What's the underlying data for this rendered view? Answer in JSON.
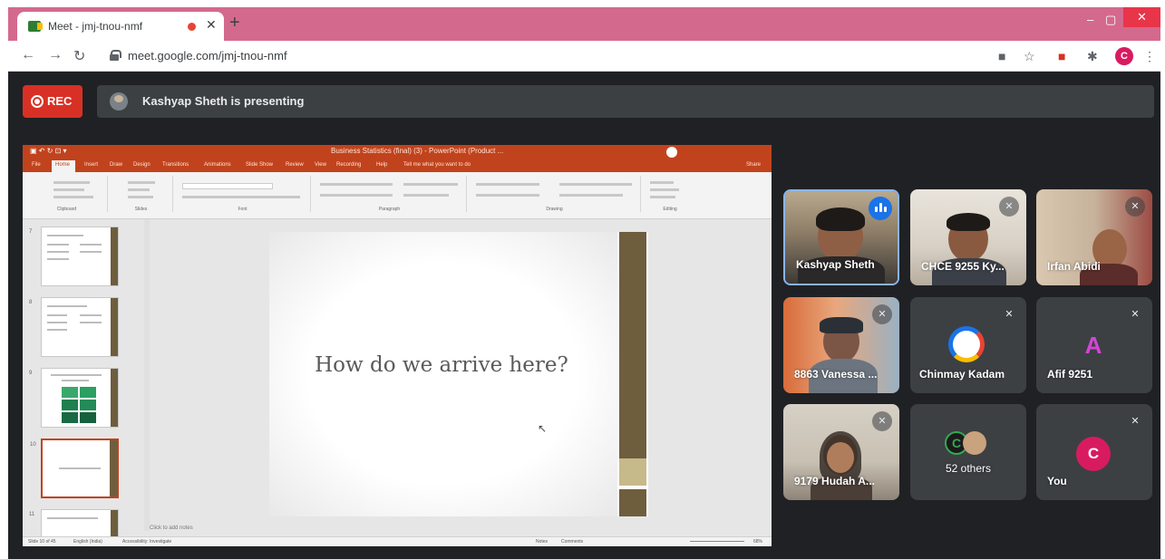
{
  "browser": {
    "tab_title": "Meet - jmj-tnou-nmf",
    "tab_close": "✕",
    "new_tab": "+",
    "url": "meet.google.com/jmj-tnou-nmf",
    "profile_initial": "C",
    "window_minimize": "–",
    "window_maximize": "▢",
    "window_close": "✕"
  },
  "meet": {
    "rec_label": "REC",
    "presenting_text": "Kashyap Sheth is presenting"
  },
  "powerpoint": {
    "title": "Business Statistics (final) (3) - PowerPoint (Product ...",
    "ribbon_tabs": [
      "File",
      "Home",
      "Insert",
      "Draw",
      "Design",
      "Transitions",
      "Animations",
      "Slide Show",
      "Review",
      "View",
      "Recording",
      "Help",
      "Tell me what you want to do",
      "Share"
    ],
    "ribbon_groups": [
      "Clipboard",
      "Slides",
      "Font",
      "Paragraph",
      "Drawing",
      "Editing"
    ],
    "slide_numbers": [
      "7",
      "8",
      "9",
      "10",
      "11"
    ],
    "slide_text": "How do we  arrive  here?",
    "notes_placeholder": "Click to add notes",
    "status_left": "Slide 10 of 45",
    "status_lang": "English (India)",
    "status_access": "Accessibility: Investigate",
    "status_notes": "Notes",
    "status_comments": "Comments",
    "zoom": "68%"
  },
  "participants": [
    {
      "name": "Kashyap Sheth",
      "speaking": true
    },
    {
      "name": "CHCE 9255 Ky...",
      "muted": true
    },
    {
      "name": "Irfan Abidi",
      "muted": true
    },
    {
      "name": "8863 Vanessa ...",
      "muted": true
    },
    {
      "name": "Chinmay Kadam",
      "muted": true,
      "avatar": "C"
    },
    {
      "name": "Afif 9251",
      "muted": true,
      "avatar": "A"
    },
    {
      "name": "9179 Hudah A...",
      "muted": true
    },
    {
      "name": "52 others"
    },
    {
      "name": "You",
      "muted": true,
      "avatar": "C"
    }
  ],
  "icons": {
    "mic_off": "mic-off-icon",
    "speaking": "speaking-icon"
  },
  "colors": {
    "meet_bg": "#202124",
    "tile_bg": "#3c4043",
    "rec_red": "#d93025",
    "tab_bar": "#d4698e",
    "ppt_orange": "#c1431d",
    "active_speaker_border": "#8ab4f8"
  }
}
